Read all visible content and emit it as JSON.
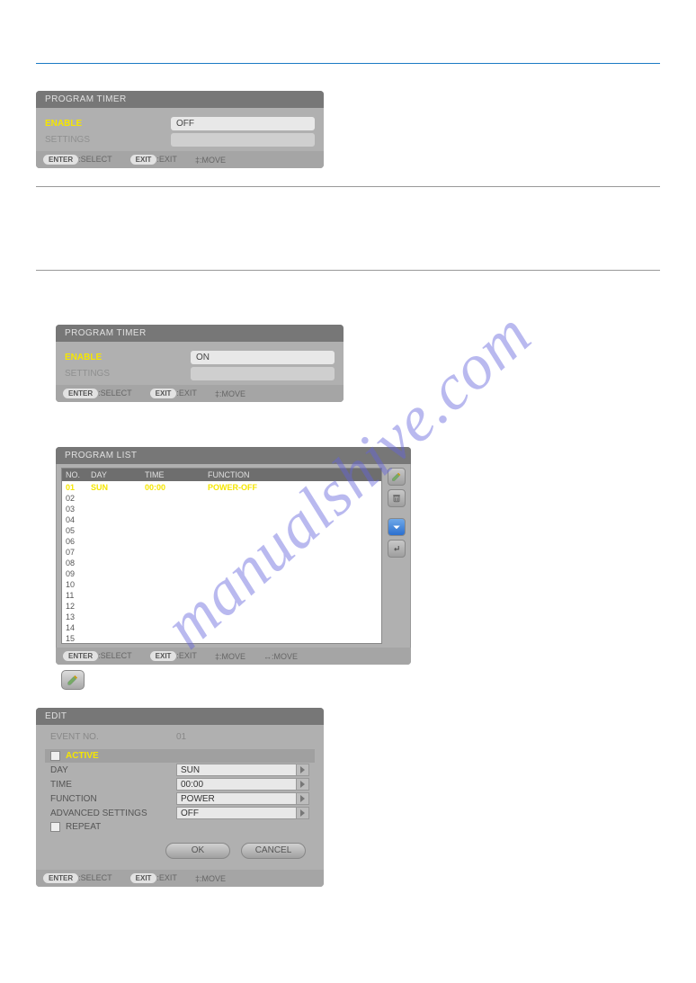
{
  "watermark": "manualshive.com",
  "hr": "",
  "panel1": {
    "title": "PROGRAM TIMER",
    "enable_label": "ENABLE",
    "enable_value": "OFF",
    "settings_label": "SETTINGS"
  },
  "panel2": {
    "title": "PROGRAM TIMER",
    "enable_label": "ENABLE",
    "enable_value": "ON",
    "settings_label": "SETTINGS"
  },
  "footer": {
    "enter": "ENTER",
    "select": ":SELECT",
    "exit_pill": "EXIT",
    "exit": ":EXIT",
    "move": "‡:MOVE",
    "move2": "↔:MOVE"
  },
  "proglist": {
    "title": "PROGRAM LIST",
    "headers": {
      "no": "NO.",
      "day": "DAY",
      "time": "TIME",
      "fn": "FUNCTION"
    },
    "rows": [
      {
        "no": "01",
        "day": "SUN",
        "time": "00:00",
        "fn": "POWER-OFF",
        "sel": true
      },
      {
        "no": "02"
      },
      {
        "no": "03"
      },
      {
        "no": "04"
      },
      {
        "no": "05"
      },
      {
        "no": "06"
      },
      {
        "no": "07"
      },
      {
        "no": "08"
      },
      {
        "no": "09"
      },
      {
        "no": "10"
      },
      {
        "no": "11"
      },
      {
        "no": "12"
      },
      {
        "no": "13"
      },
      {
        "no": "14"
      },
      {
        "no": "15"
      }
    ]
  },
  "edit": {
    "title": "EDIT",
    "event_label": "EVENT NO.",
    "event_no": "01",
    "active": "ACTIVE",
    "day_label": "DAY",
    "day_value": "SUN",
    "time_label": "TIME",
    "time_value": "00:00",
    "fn_label": "FUNCTION",
    "fn_value": "POWER",
    "adv_label": "ADVANCED SETTINGS",
    "adv_value": "OFF",
    "repeat": "REPEAT",
    "ok": "OK",
    "cancel": "CANCEL"
  }
}
